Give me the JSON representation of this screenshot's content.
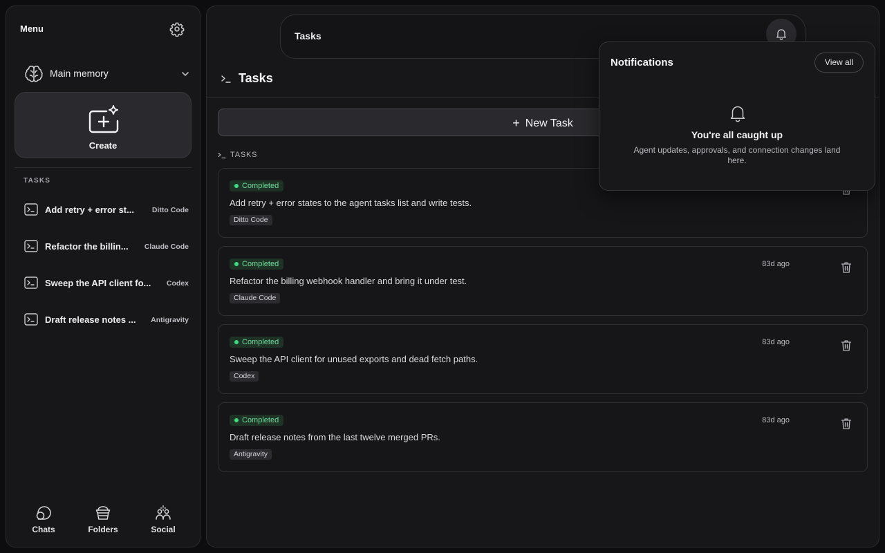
{
  "sidebar": {
    "title": "Menu",
    "memory_label": "Main memory",
    "create_label": "Create",
    "section_label": "TASKS",
    "tasks": [
      {
        "title": "Add retry + error st...",
        "agent": "Ditto Code"
      },
      {
        "title": "Refactor the billin...",
        "agent": "Claude Code"
      },
      {
        "title": "Sweep the API client fo...",
        "agent": "Codex"
      },
      {
        "title": "Draft release notes ...",
        "agent": "Antigravity"
      }
    ],
    "nav": [
      {
        "label": "Chats",
        "icon": "chat-bubble-icon"
      },
      {
        "label": "Folders",
        "icon": "basket-icon"
      },
      {
        "label": "Social",
        "icon": "people-sparkle-icon"
      }
    ]
  },
  "topbar": {
    "title": "Tasks"
  },
  "page": {
    "title": "Tasks",
    "new_task_label": "New Task",
    "section_label": "TASKS"
  },
  "tasks": [
    {
      "status": "Completed",
      "time": "",
      "description": "Add retry + error states to the agent tasks list and write tests.",
      "agent": "Ditto Code"
    },
    {
      "status": "Completed",
      "time": "83d ago",
      "description": "Refactor the billing webhook handler and bring it under test.",
      "agent": "Claude Code"
    },
    {
      "status": "Completed",
      "time": "83d ago",
      "description": "Sweep the API client for unused exports and dead fetch paths.",
      "agent": "Codex"
    },
    {
      "status": "Completed",
      "time": "83d ago",
      "description": "Draft release notes from the last twelve merged PRs.",
      "agent": "Antigravity"
    }
  ],
  "notifications": {
    "title": "Notifications",
    "view_all_label": "View all",
    "empty_title": "You're all caught up",
    "empty_body": "Agent updates, approvals, and connection changes land here."
  },
  "colors": {
    "background": "#0d0d0f",
    "panel": "#17171a",
    "status_green": "#3ddc84"
  }
}
